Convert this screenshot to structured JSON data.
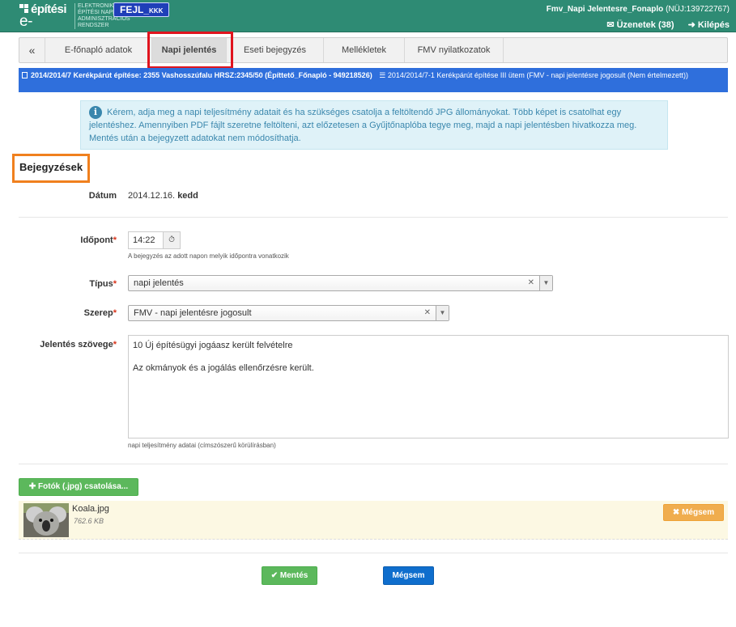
{
  "header": {
    "logo_top": "építési",
    "logo_bottom": "e-napló",
    "logo_sub": [
      "ELEKTRONIKUS",
      "ÉPÍTÉSI NAPLÓ",
      "ADMINISZTRÁCIÓS",
      "RENDSZER"
    ],
    "env_badge": "FEJL",
    "env_badge_small": "KKK",
    "user_name": "Fmv_Napi Jelentesre_Fonaplo",
    "user_id": "(NÜJ:139722767)",
    "messages": "Üzenetek (38)",
    "logout": "Kilépés"
  },
  "tabs": [
    {
      "label": "«"
    },
    {
      "label": "E-főnapló adatok"
    },
    {
      "label": "Napi jelentés"
    },
    {
      "label": "Eseti bejegyzés"
    },
    {
      "label": "Mellékletek"
    },
    {
      "label": "FMV nyilatkozatok"
    }
  ],
  "breadcrumb": {
    "project": "2014/2014/7 Kerékpárút építése: 2355 Vashosszúfalu HRSZ:2345/50 (Építtető_Főnapló - 949218526)",
    "subproject": "2014/2014/7-1 Kerékpárút építése III ütem (FMV - napi jelentésre jogosult (Nem értelmezett))"
  },
  "info": {
    "text": "Kérem, adja meg a napi teljesítmény adatait és ha szükséges csatolja a feltöltendő JPG állományokat. Több képet is csatolhat egy jelentéshez. Amennyiben PDF fájlt szeretne feltölteni, azt előzetesen a Gyűjtőnaplóba tegye meg, majd a napi jelentésben hivatkozza meg. Mentés után a bejegyzett adatokat nem módosíthatja."
  },
  "form": {
    "section_title": "Bejegyzések",
    "date_label": "Dátum",
    "date_value": "2014.12.16.",
    "date_day": "kedd",
    "time_label": "Időpont",
    "time_value": "14:22",
    "time_hint": "A bejegyzés az adott napon melyik időpontra vonatkozik",
    "type_label": "Típus",
    "type_value": "napi jelentés",
    "role_label": "Szerep",
    "role_value": "FMV - napi jelentésre jogosult",
    "text_label": "Jelentés szövege",
    "text_value": "10 Új építésügyi jogáasz került felvételre\n\nAz okmányok és a jogálás ellenőrzésre került.",
    "text_hint": "napi teljesítmény adatai (címszószerű körülírásban)"
  },
  "attachments": {
    "add_button": "Fotók (.jpg) csatolása...",
    "file_name": "Koala.jpg",
    "file_size": "762.6 KB",
    "cancel_button": "Mégsem"
  },
  "actions": {
    "save_button": "Mentés",
    "cancel_button": "Mégsem"
  },
  "colors": {
    "header": "#2e8b74",
    "breadcrumb": "#2f6fdc",
    "highlight_red": "#e0141e",
    "highlight_orange": "#f0801e"
  }
}
